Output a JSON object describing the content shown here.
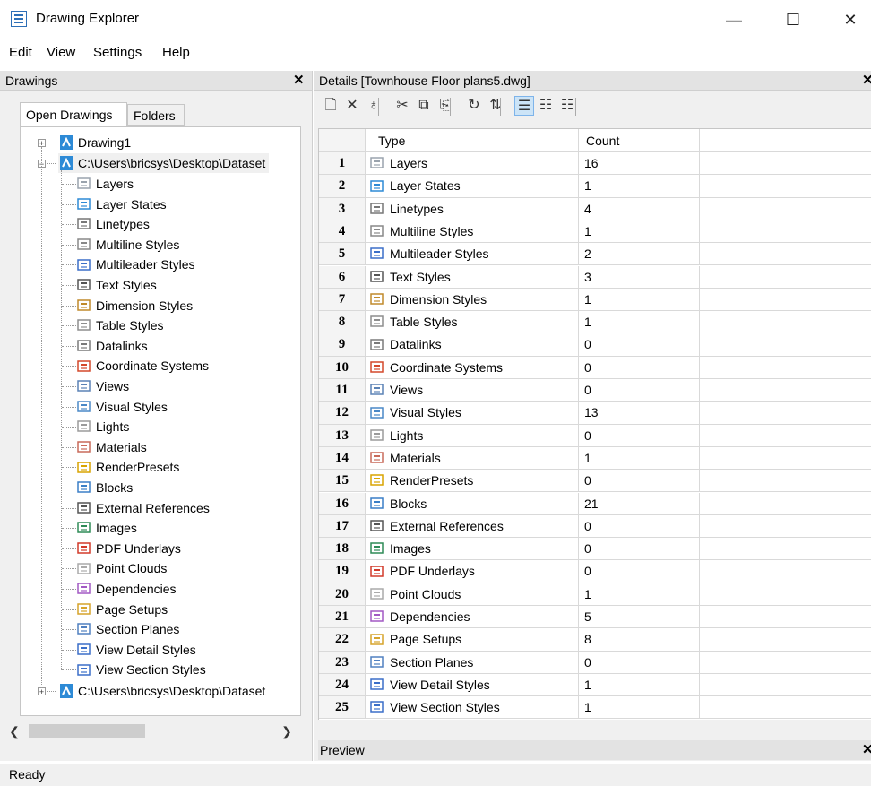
{
  "window": {
    "title": "Drawing Explorer",
    "minimize": "—",
    "maximize": "☐",
    "close": "✕"
  },
  "menu": [
    "Edit",
    "View",
    "Settings",
    "Help"
  ],
  "left_panel": {
    "title": "Drawings",
    "close": "✕",
    "tabs": [
      "Open Drawings",
      "Folders"
    ],
    "active_tab": "Open Drawings",
    "tree": {
      "drawing1": "Drawing1",
      "dataset1": "C:\\Users\\bricsys\\Desktop\\Dataset",
      "dataset2": "C:\\Users\\bricsys\\Desktop\\Dataset",
      "children": [
        {
          "label": "Layers",
          "icon": "layers-icon"
        },
        {
          "label": "Layer States",
          "icon": "layer-states-icon"
        },
        {
          "label": "Linetypes",
          "icon": "linetypes-icon"
        },
        {
          "label": "Multiline Styles",
          "icon": "multiline-styles-icon"
        },
        {
          "label": "Multileader Styles",
          "icon": "multileader-styles-icon"
        },
        {
          "label": "Text Styles",
          "icon": "text-styles-icon"
        },
        {
          "label": "Dimension Styles",
          "icon": "dimension-styles-icon"
        },
        {
          "label": "Table Styles",
          "icon": "table-styles-icon"
        },
        {
          "label": "Datalinks",
          "icon": "datalinks-icon"
        },
        {
          "label": "Coordinate Systems",
          "icon": "coordinate-systems-icon"
        },
        {
          "label": "Views",
          "icon": "views-icon"
        },
        {
          "label": "Visual Styles",
          "icon": "visual-styles-icon"
        },
        {
          "label": "Lights",
          "icon": "lights-icon"
        },
        {
          "label": "Materials",
          "icon": "materials-icon"
        },
        {
          "label": "RenderPresets",
          "icon": "render-presets-icon"
        },
        {
          "label": "Blocks",
          "icon": "blocks-icon"
        },
        {
          "label": "External References",
          "icon": "external-references-icon"
        },
        {
          "label": "Images",
          "icon": "images-icon"
        },
        {
          "label": "PDF Underlays",
          "icon": "pdf-underlays-icon"
        },
        {
          "label": "Point Clouds",
          "icon": "point-clouds-icon"
        },
        {
          "label": "Dependencies",
          "icon": "dependencies-icon"
        },
        {
          "label": "Page Setups",
          "icon": "page-setups-icon"
        },
        {
          "label": "Section Planes",
          "icon": "section-planes-icon"
        },
        {
          "label": "View Detail Styles",
          "icon": "view-detail-styles-icon"
        },
        {
          "label": "View Section Styles",
          "icon": "view-section-styles-icon"
        }
      ]
    }
  },
  "details": {
    "title": "Details [Townhouse Floor plans5.dwg]",
    "close": "✕",
    "columns": {
      "type": "Type",
      "count": "Count"
    },
    "rows": [
      {
        "n": "1",
        "type": "Layers",
        "count": "16"
      },
      {
        "n": "2",
        "type": "Layer States",
        "count": "1"
      },
      {
        "n": "3",
        "type": "Linetypes",
        "count": "4"
      },
      {
        "n": "4",
        "type": "Multiline Styles",
        "count": "1"
      },
      {
        "n": "5",
        "type": "Multileader Styles",
        "count": "2"
      },
      {
        "n": "6",
        "type": "Text Styles",
        "count": "3"
      },
      {
        "n": "7",
        "type": "Dimension Styles",
        "count": "1"
      },
      {
        "n": "8",
        "type": "Table Styles",
        "count": "1"
      },
      {
        "n": "9",
        "type": "Datalinks",
        "count": "0"
      },
      {
        "n": "10",
        "type": "Coordinate Systems",
        "count": "0"
      },
      {
        "n": "11",
        "type": "Views",
        "count": "0"
      },
      {
        "n": "12",
        "type": "Visual Styles",
        "count": "13"
      },
      {
        "n": "13",
        "type": "Lights",
        "count": "0"
      },
      {
        "n": "14",
        "type": "Materials",
        "count": "1"
      },
      {
        "n": "15",
        "type": "RenderPresets",
        "count": "0"
      },
      {
        "n": "16",
        "type": "Blocks",
        "count": "21"
      },
      {
        "n": "17",
        "type": "External References",
        "count": "0"
      },
      {
        "n": "18",
        "type": "Images",
        "count": "0"
      },
      {
        "n": "19",
        "type": "PDF Underlays",
        "count": "0"
      },
      {
        "n": "20",
        "type": "Point Clouds",
        "count": "1"
      },
      {
        "n": "21",
        "type": "Dependencies",
        "count": "5"
      },
      {
        "n": "22",
        "type": "Page Setups",
        "count": "8"
      },
      {
        "n": "23",
        "type": "Section Planes",
        "count": "0"
      },
      {
        "n": "24",
        "type": "View Detail Styles",
        "count": "1"
      },
      {
        "n": "25",
        "type": "View Section Styles",
        "count": "1"
      }
    ]
  },
  "toolbar": [
    {
      "name": "new-icon",
      "glyph": "🗋"
    },
    {
      "name": "delete-icon",
      "glyph": "✕"
    },
    {
      "name": "purge-icon",
      "glyph": "♁"
    },
    {
      "name": "cut-icon",
      "glyph": "✂"
    },
    {
      "name": "copy-icon",
      "glyph": "⧉"
    },
    {
      "name": "paste-icon",
      "glyph": "⎘"
    },
    {
      "name": "import-icon",
      "glyph": "↻"
    },
    {
      "name": "refresh-icon",
      "glyph": "⇅"
    },
    {
      "name": "details-view-icon",
      "glyph": "☰"
    },
    {
      "name": "list-view-icon",
      "glyph": "☷"
    },
    {
      "name": "tree-view-icon",
      "glyph": "☷"
    }
  ],
  "preview": {
    "title": "Preview",
    "close": "✕"
  },
  "status": "Ready",
  "colors": {
    "accent": "#2d6fb7",
    "active_toolbar": "#cce4f7"
  }
}
